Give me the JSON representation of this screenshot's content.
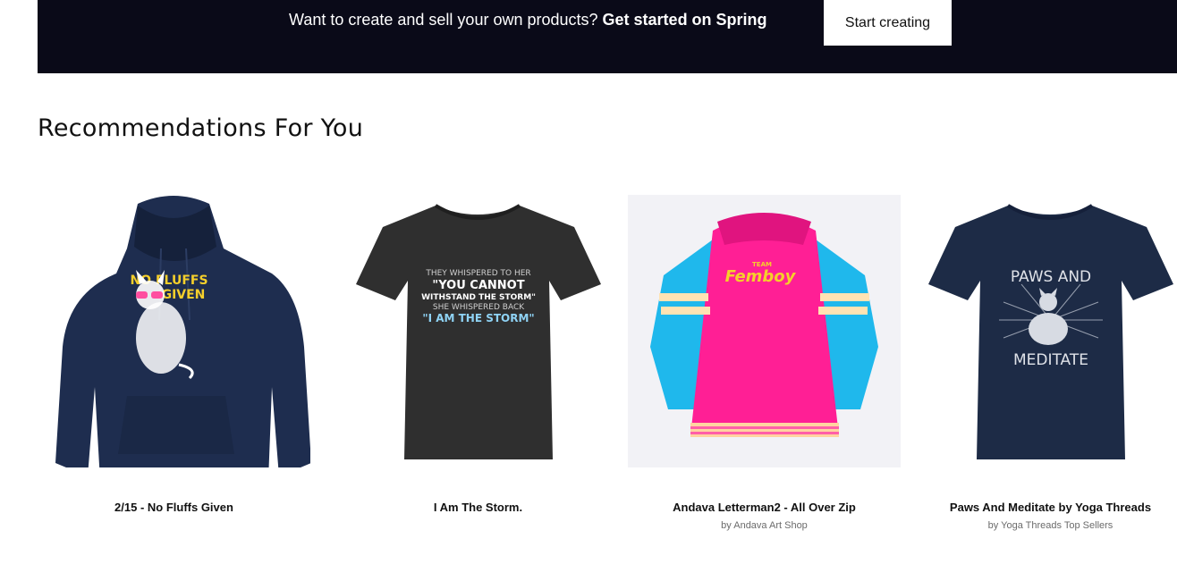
{
  "banner": {
    "text": "Want to create and sell your own products? ",
    "bold_text": "Get started on Spring",
    "cta_label": "Start creating"
  },
  "section_title": "Recommendations For You",
  "products": [
    {
      "title": "2/15 - No Fluffs Given",
      "seller": "",
      "print_lines": [
        "NO FLUFFS",
        "GIVEN"
      ],
      "garment_color": "#1e2d4f",
      "garment": "hoodie-icon"
    },
    {
      "title": "I Am The Storm.",
      "seller": "",
      "print_lines": [
        "THEY WHISPERED TO HER",
        "\"YOU CANNOT",
        "WITHSTAND THE STORM\"",
        "SHE WHISPERED BACK",
        "\"I AM THE STORM\""
      ],
      "garment_color": "#2f2f2f",
      "garment": "tshirt-icon"
    },
    {
      "title": "Andava Letterman2 - All Over Zip",
      "seller": "by Andava Art Shop",
      "print_lines": [
        "TEAM",
        "Femboy"
      ],
      "garment_color": "#ff1f95",
      "garment": "letterman-jacket-icon"
    },
    {
      "title": "Paws And Meditate by Yoga Threads",
      "seller": "by Yoga Threads Top Sellers",
      "print_lines": [
        "PAWS AND",
        "MEDITATE"
      ],
      "garment_color": "#1d2b46",
      "garment": "tshirt-icon"
    }
  ]
}
